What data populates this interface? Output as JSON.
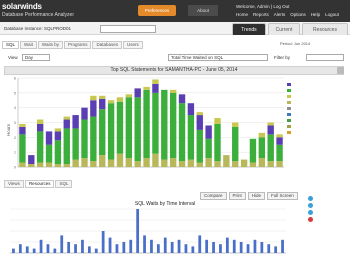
{
  "topbar": {
    "logo": "solarwinds",
    "subtitle": "Database Performance Analyzer",
    "preferences_label": "Preferences",
    "about_label": "About",
    "user_line": "Welcome, Admin | Log Out",
    "nav_links": [
      "Home",
      "Reports",
      "Alerts",
      "Options",
      "Help",
      "Logout"
    ]
  },
  "instance": {
    "label": "Database Instance: SQLPROD01",
    "selected": ""
  },
  "main_tabs": [
    "Trends",
    "Current",
    "Resources"
  ],
  "sub_tabs": [
    "SQL",
    "Wait",
    "Waits by",
    "Programs",
    "Databases",
    "Users"
  ],
  "period_note": "Period: Jun 2014",
  "controls": {
    "view_label": "View",
    "view_value": "Day",
    "metric_value": "Total Time Waited on SQL",
    "filter_label": "Filter by",
    "filter_value": ""
  },
  "chart_data": {
    "type": "bar",
    "title": "Top SQL Statements for SAMANTHA-PC - June 05, 2014",
    "ylabel": "Hours",
    "stacked": true,
    "ylim": [
      0,
      6
    ],
    "categories": [
      "1",
      "2",
      "3",
      "4",
      "5",
      "6",
      "7",
      "8",
      "9",
      "10",
      "11",
      "12",
      "13",
      "14",
      "15",
      "16",
      "17",
      "18",
      "19",
      "20",
      "21",
      "22",
      "23",
      "24",
      "25",
      "26",
      "27",
      "28",
      "29",
      "30"
    ],
    "series": [
      {
        "name": "",
        "color": "#b8b85a",
        "values": [
          0.3,
          0.2,
          0.3,
          0.3,
          0.2,
          0.2,
          0.5,
          0.6,
          0.4,
          0.8,
          0.5,
          0.9,
          0.6,
          0.4,
          0.6,
          0.9,
          0.5,
          0.6,
          0.4,
          0.5,
          0.3,
          0.6,
          0.4,
          0.8,
          0.4,
          0.5,
          0.3,
          0.6,
          0.4,
          0.4
        ]
      },
      {
        "name": "",
        "color": "#3cae3c",
        "values": [
          1.9,
          0.0,
          2.1,
          1.2,
          1.6,
          2.4,
          2.1,
          2.6,
          3.0,
          3.1,
          3.8,
          3.5,
          4.1,
          4.3,
          4.6,
          4.1,
          4.7,
          4.4,
          3.9,
          3.0,
          2.2,
          1.3,
          2.5,
          0.0,
          2.3,
          0.0,
          1.6,
          1.4,
          1.8,
          1.1
        ]
      },
      {
        "name": "",
        "color": "#5a3fb3",
        "values": [
          0.5,
          0.6,
          0.5,
          0.9,
          0.6,
          0.6,
          0.9,
          0.8,
          1.1,
          0.7,
          0.0,
          0.0,
          0.0,
          0.6,
          0.0,
          0.6,
          0.0,
          0.0,
          0.6,
          0.8,
          1.0,
          0.9,
          0.0,
          0.0,
          0.0,
          0.0,
          0.0,
          0.0,
          0.6,
          0.5
        ]
      },
      {
        "name": "",
        "color": "#c8c850",
        "values": [
          0.2,
          0.0,
          0.3,
          0.0,
          0.2,
          0.2,
          0.0,
          0.0,
          0.3,
          0.2,
          0.2,
          0.3,
          0.2,
          0.0,
          0.2,
          0.3,
          0.0,
          0.2,
          0.0,
          0.0,
          0.2,
          0.0,
          0.4,
          0.0,
          0.3,
          0.0,
          0.0,
          0.3,
          0.2,
          0.2
        ]
      }
    ],
    "legend_position": "right"
  },
  "legend_items": [
    {
      "label": "",
      "color": "#5a3fb3"
    },
    {
      "label": "",
      "color": "#3cae3c"
    },
    {
      "label": "",
      "color": "#c8c850"
    },
    {
      "label": "",
      "color": "#b8b85a"
    },
    {
      "label": "",
      "color": "#8f8f8f"
    },
    {
      "label": "",
      "color": "#3c7ac6"
    },
    {
      "label": "",
      "color": "#46a046"
    },
    {
      "label": "",
      "color": "#a0a040"
    },
    {
      "label": "",
      "color": "#d0a030"
    }
  ],
  "bottom": {
    "tabs": [
      "Views",
      "Resources",
      "SQL"
    ],
    "buttons": [
      "Compare",
      "Print",
      "Hide",
      "Full Screen"
    ],
    "lower_title": "SQL Waits by Time Interval",
    "side_items": [
      {
        "label": "",
        "color": "#3aa0d8"
      },
      {
        "label": "",
        "color": "#3aa0d8"
      },
      {
        "label": "",
        "color": "#3aa0d8"
      },
      {
        "label": "",
        "color": "#d83a3a"
      }
    ]
  },
  "lower_chart_data": {
    "type": "bar",
    "values": [
      0.1,
      0.2,
      0.15,
      0.1,
      0.3,
      0.2,
      0.1,
      0.4,
      0.25,
      0.2,
      0.3,
      0.15,
      0.1,
      0.5,
      0.35,
      0.2,
      0.25,
      0.3,
      1.0,
      0.4,
      0.3,
      0.2,
      0.35,
      0.25,
      0.3,
      0.2,
      0.15,
      0.4,
      0.3,
      0.25,
      0.2,
      0.35,
      0.3,
      0.25,
      0.2,
      0.3,
      0.25,
      0.2,
      0.15,
      0.3
    ],
    "ylim": [
      0,
      1
    ]
  }
}
